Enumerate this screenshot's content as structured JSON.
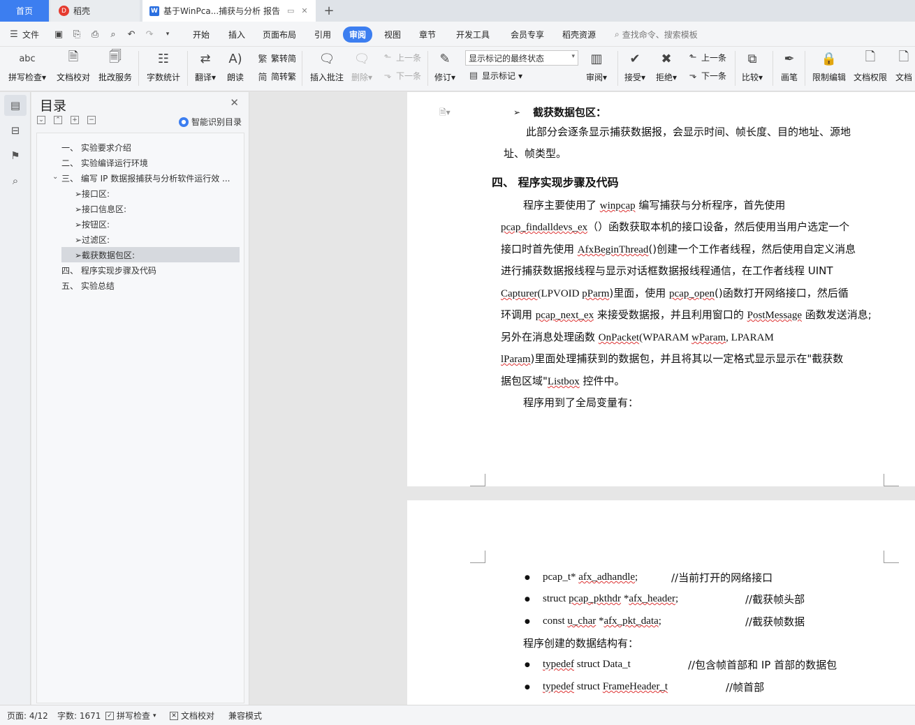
{
  "tabs": {
    "home": "首页",
    "daoke": "稻壳",
    "doc": "基于WinPca...捕获与分析 报告"
  },
  "menu": {
    "file": "文件",
    "items": [
      "开始",
      "插入",
      "页面布局",
      "引用",
      "审阅",
      "视图",
      "章节",
      "开发工具",
      "会员专享",
      "稻壳资源"
    ],
    "active": "审阅",
    "search": "查找命令、搜索模板"
  },
  "ribbon": {
    "spell_check": "拼写检查",
    "doc_proof": "文档校对",
    "batch_revise": "批改服务",
    "word_count": "字数统计",
    "translate": "翻译",
    "read_aloud": "朗读",
    "t2s": "繁转简",
    "s2t": "简转繁",
    "insert_comment": "插入批注",
    "delete": "删除",
    "prev_comment": "上一条",
    "next_comment": "下一条",
    "track": "修订",
    "markup_state": "显示标记的最终状态",
    "show_markup": "显示标记",
    "review": "审阅",
    "accept": "接受",
    "reject": "拒绝",
    "prev_change": "上一条",
    "next_change": "下一条",
    "compare": "比较",
    "pen": "画笔",
    "restrict": "限制编辑",
    "doc_rights": "文档权限",
    "doc_more": "文档"
  },
  "toc": {
    "title": "目录",
    "smart": "智能识别目录",
    "items": [
      "一、  实验要求介绍",
      "二、  实验编译运行环境",
      "三、  编写 IP 数据报捕获与分析软件运行效 ...",
      "➢接口区:",
      "➢接口信息区:",
      "➢按钮区:",
      "➢过滤区:",
      "➢截获数据包区:",
      "四、  程序实现步骤及代码",
      "五、  实验总结"
    ]
  },
  "doc": {
    "p1_bullet_heading": "截获数据包区：",
    "p1_line1": "此部分会逐条显示捕获数据报，会显示时间、帧长度、目的地址、源地",
    "p1_line2": "址、帧类型。",
    "h4": "四、   程序实现步骤及代码",
    "l1a": "程序主要使用了 ",
    "l1b": "winpcap",
    "l1c": " 编写捕获与分析程序，首先使用",
    "l2a": "pcap_findalldevs_ex",
    "l2b": "（）函数获取本机的接口设备，然后使用当用户选定一个",
    "l3a": "接口时首先使用 ",
    "l3b": "AfxBeginThread",
    "l3c": "()创建一个工作者线程，然后使用自定义消息",
    "l4": "进行捕获数据报线程与显示对话框数据报线程通信，在工作者线程 UINT",
    "l5a": "Capturer",
    "l5b": "(LPVOID ",
    "l5c": "pParm",
    "l5d": ")里面，使用 ",
    "l5e": "pcap_open",
    "l5f": "()函数打开网络接口，然后循",
    "l6a": "环调用 ",
    "l6b": "pcap_next_ex",
    "l6c": " 来接受数据报，并且利用窗口的 ",
    "l6d": "PostMessage",
    "l6e": " 函数发送消息;",
    "l7a": "另外在消息处理函数 ",
    "l7b": "OnPacket",
    "l7c": "(WPARAM ",
    "l7d": "wParam",
    "l7e": ", LPARAM",
    "l8a": "lParam",
    "l8b": ")里面处理捕获到的数据包，并且将其以一定格式显示显示在\"截获数",
    "l9a": "据包区域\"",
    "l9b": "Listbox",
    "l9c": " 控件中。",
    "l10": "程序用到了全局变量有：",
    "g1a": "pcap_t* ",
    "g1b": "afx_adhandle",
    "g1c": ";",
    "g1d": "//当前打开的网络接口",
    "g2a": "struct ",
    "g2b": "pcap_pkthdr",
    "g2c": " *",
    "g2d": "afx_header",
    "g2e": ";",
    "g2f": "//截获帧头部",
    "g3a": "const ",
    "g3b": "u_char",
    "g3c": " *",
    "g3d": "afx_pkt_data",
    "g3e": ";",
    "g3f": "//截获帧数据",
    "s1": "程序创建的数据结构有：",
    "d1a": "typedef",
    "d1b": " struct Data_t",
    "d1c": "//包含帧首部和 IP 首部的数据包",
    "d2a": "typedef",
    "d2b": " struct ",
    "d2c": "FrameHeader_t",
    "d2d": "//帧首部"
  },
  "status": {
    "page": "页面: 4/12",
    "words": "字数: 1671",
    "spell": "拼写检查",
    "proof": "文档校对",
    "compat": "兼容模式"
  },
  "colors": {
    "accent": "#3c7ef0",
    "spell_underline": "#d33"
  }
}
